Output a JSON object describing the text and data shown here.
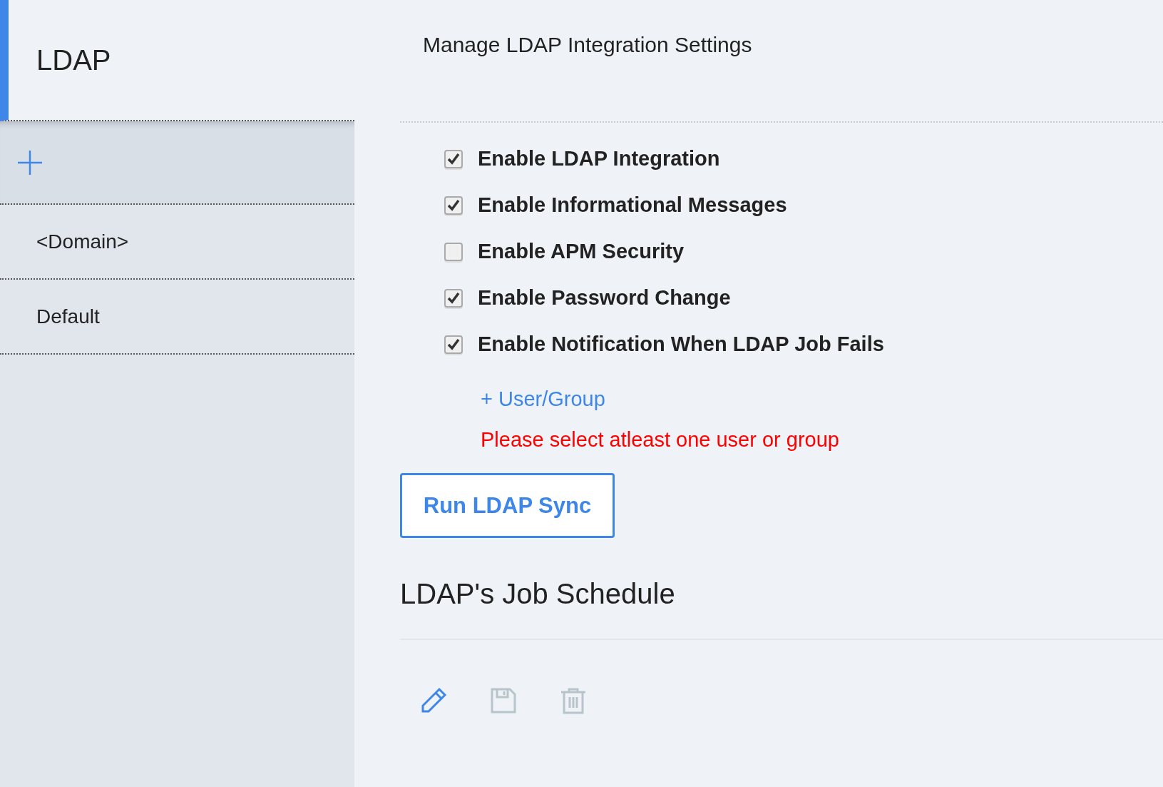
{
  "sidebar": {
    "title": "LDAP",
    "items": [
      "<Domain>",
      "Default"
    ]
  },
  "main": {
    "title": "Manage LDAP Integration Settings",
    "options": [
      {
        "label": "Enable LDAP Integration",
        "checked": true
      },
      {
        "label": "Enable Informational Messages",
        "checked": true
      },
      {
        "label": "Enable APM Security",
        "checked": false
      },
      {
        "label": "Enable Password Change",
        "checked": true
      },
      {
        "label": "Enable Notification When LDAP Job Fails",
        "checked": true
      }
    ],
    "add_link": "+ User/Group",
    "error": "Please select atleast one user or group",
    "sync_button": "Run LDAP Sync",
    "schedule_title": "LDAP's Job Schedule",
    "toolbar": [
      {
        "kind": "edit",
        "disabled": false
      },
      {
        "kind": "save",
        "disabled": true
      },
      {
        "kind": "delete",
        "disabled": true
      }
    ]
  }
}
